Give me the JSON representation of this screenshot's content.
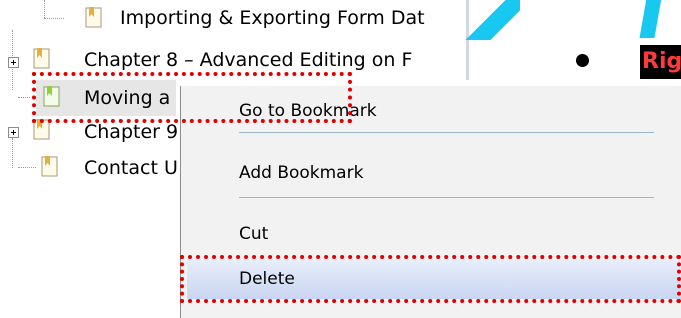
{
  "tree": {
    "items": [
      {
        "label": "Importing & Exporting Form Dat"
      },
      {
        "label": "Chapter 8 – Advanced Editing on F"
      },
      {
        "label": "Moving a"
      },
      {
        "label": "Chapter 9"
      },
      {
        "label": "Contact U"
      }
    ]
  },
  "right": {
    "corner_text": "Rig"
  },
  "context_menu": {
    "items": [
      {
        "label": "Go to Bookmark"
      },
      {
        "label": "Add Bookmark"
      },
      {
        "label": "Cut"
      },
      {
        "label": "Delete"
      }
    ]
  },
  "colors": {
    "highlight_red": "#e00000",
    "menu_bg": "#f2f2f2",
    "accent_blue": "#19c8f0"
  },
  "icons": [
    "bookmark-icon",
    "expand-icon",
    "bullet-icon"
  ]
}
